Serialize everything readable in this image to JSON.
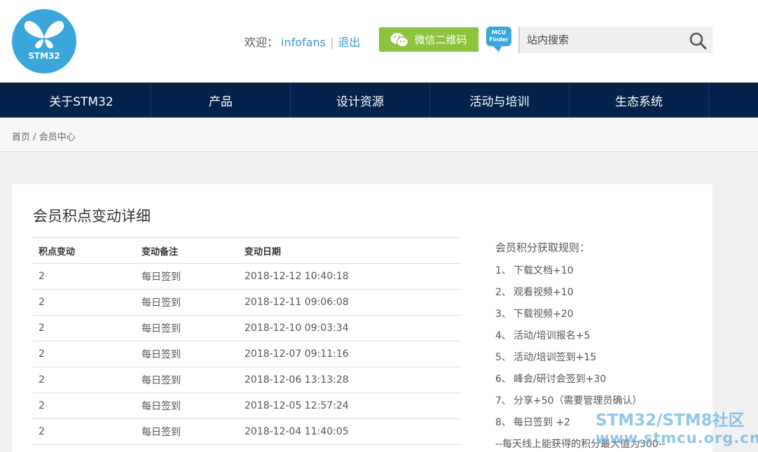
{
  "header": {
    "logo_text": "STM32",
    "welcome_label": "欢迎：",
    "username": "infofans",
    "separator": "|",
    "logout": "退出",
    "wechat_button": "微信二维码",
    "mcu_finder_line1": "MCU",
    "mcu_finder_line2": "Finder",
    "search_placeholder": "站内搜索"
  },
  "nav": {
    "items": [
      {
        "label": "关于STM32"
      },
      {
        "label": "产品"
      },
      {
        "label": "设计资源"
      },
      {
        "label": "活动与培训"
      },
      {
        "label": "生态系统"
      }
    ]
  },
  "breadcrumb": {
    "text": "首页 / 会员中心"
  },
  "main": {
    "title": "会员积点变动详细",
    "table": {
      "headers": [
        "积点变动",
        "变动备注",
        "变动日期"
      ],
      "rows": [
        [
          "2",
          "每日签到",
          "2018-12-12 10:40:18"
        ],
        [
          "2",
          "每日签到",
          "2018-12-11 09:06:08"
        ],
        [
          "2",
          "每日签到",
          "2018-12-10 09:03:34"
        ],
        [
          "2",
          "每日签到",
          "2018-12-07 09:11:16"
        ],
        [
          "2",
          "每日签到",
          "2018-12-06 13:13:28"
        ],
        [
          "2",
          "每日签到",
          "2018-12-05 12:57:24"
        ],
        [
          "2",
          "每日签到",
          "2018-12-04 11:40:05"
        ]
      ]
    },
    "rules": {
      "title": "会员积分获取规则：",
      "items": [
        {
          "num": "1、",
          "text": "下载文档+10"
        },
        {
          "num": "2、",
          "text": "观看视频+10"
        },
        {
          "num": "3、",
          "text": "下载视频+20"
        },
        {
          "num": "4、",
          "text": "活动/培训报名+5"
        },
        {
          "num": "5、",
          "text": "活动/培训签到+15"
        },
        {
          "num": "6、",
          "text": "峰会/研讨会签到+30"
        },
        {
          "num": "7、",
          "text": "分享+50（需要管理员确认）"
        },
        {
          "num": "8、",
          "text": "每日签到 +2"
        }
      ],
      "note": "--每天线上能获得的积分最大值为300--"
    }
  },
  "watermark": {
    "line1": "STM32/STM8社区",
    "line2": "www.stmcu.org.cn"
  },
  "colors": {
    "nav_bg": "#03234b",
    "wechat_green": "#8cc43e",
    "logo_blue": "#3aa6dc",
    "link_blue": "#3a9bd6"
  }
}
